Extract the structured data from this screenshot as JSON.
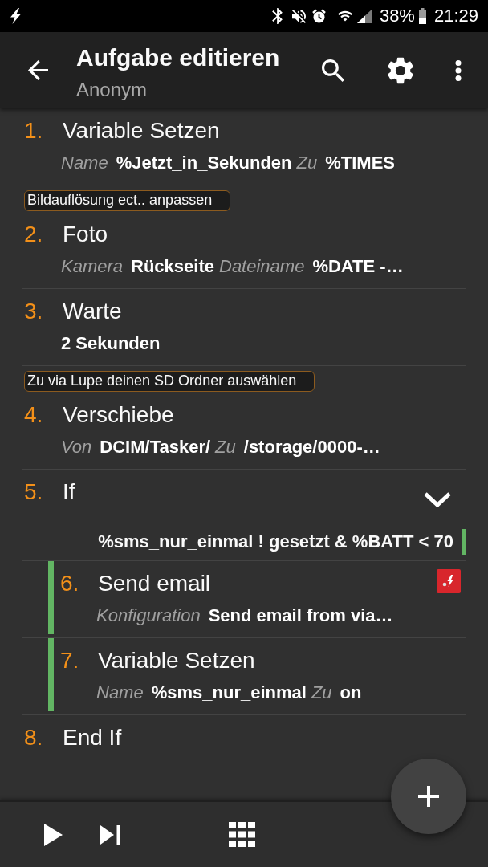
{
  "status_bar": {
    "battery_text": "38%",
    "time": "21:29"
  },
  "app_bar": {
    "title": "Aufgabe editieren",
    "subtitle": "Anonym"
  },
  "actions": [
    {
      "kind": "action",
      "number": "1.",
      "name": "Variable Setzen",
      "args": [
        {
          "param": "Name",
          "value": "%Jetzt_in_Sekunden"
        },
        {
          "param": "Zu",
          "value": "%TIMES"
        }
      ]
    },
    {
      "kind": "action",
      "label": "Bildauflösung ect.. anpassen",
      "number": "2.",
      "name": "Foto",
      "args": [
        {
          "param": "Kamera",
          "value": "Rückseite"
        },
        {
          "param": "Dateiname",
          "value": "%DATE -…"
        }
      ]
    },
    {
      "kind": "action",
      "number": "3.",
      "name": "Warte",
      "args": [
        {
          "value": "2 Sekunden"
        }
      ]
    },
    {
      "kind": "action",
      "label": "Zu via Lupe deinen SD Ordner auswählen",
      "number": "4.",
      "name": "Verschiebe",
      "args": [
        {
          "param": "Von",
          "value": "DCIM/Tasker/"
        },
        {
          "param": "Zu",
          "value": "/storage/0000-…"
        }
      ]
    },
    {
      "kind": "if",
      "number": "5.",
      "name": "If",
      "expanded": true,
      "condition": "%sms_nur_einmal ! gesetzt & %BATT < 70",
      "children": [
        {
          "kind": "plugin",
          "number": "6.",
          "name": "Send email",
          "args": [
            {
              "param": "Konfiguration",
              "value": "Send email from via…"
            }
          ]
        },
        {
          "kind": "action",
          "number": "7.",
          "name": "Variable Setzen",
          "args": [
            {
              "param": "Name",
              "value": "%sms_nur_einmal"
            },
            {
              "param": "Zu",
              "value": "on"
            }
          ]
        }
      ]
    },
    {
      "kind": "action",
      "number": "8.",
      "name": "End If"
    }
  ]
}
